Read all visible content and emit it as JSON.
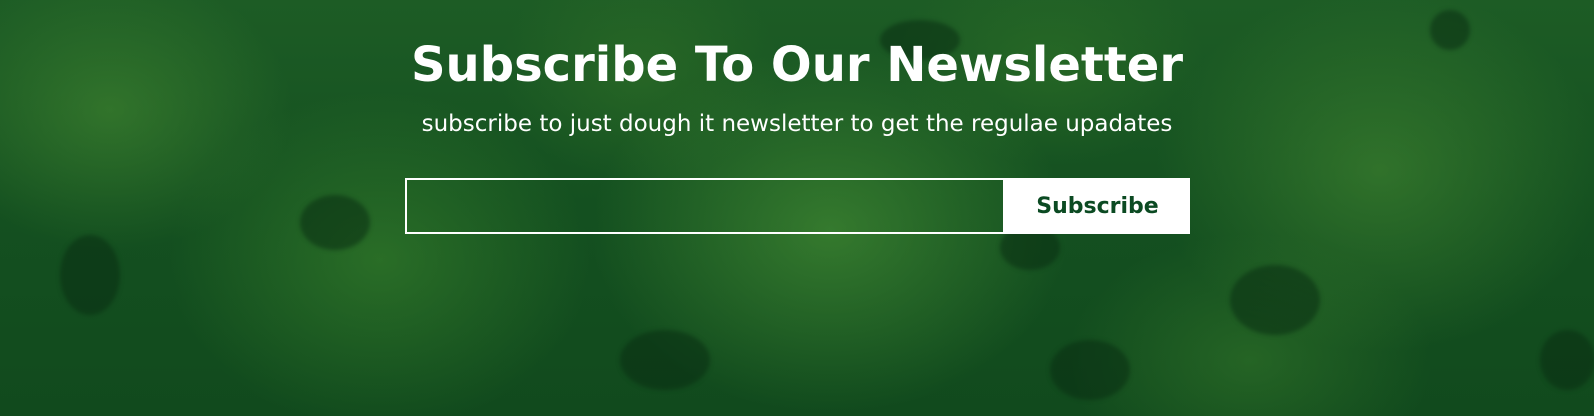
{
  "newsletter": {
    "title": "Subscribe To Our Newsletter",
    "subtitle": "subscribe to just dough it newsletter to get the regulae upadates",
    "email_input": {
      "value": "",
      "placeholder": ""
    },
    "subscribe_label": "Subscribe"
  },
  "colors": {
    "background_overlay": "#0e4a1c",
    "text": "#ffffff",
    "button_background": "#ffffff",
    "button_text": "#0b4a22"
  }
}
